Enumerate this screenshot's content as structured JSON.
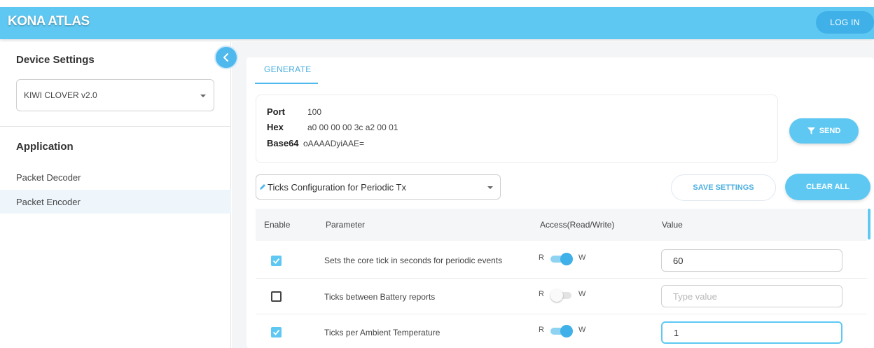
{
  "app": {
    "brand": "KONA ATLAS",
    "login_label": "LOG IN"
  },
  "sidebar": {
    "device_settings_title": "Device Settings",
    "device_selected": "KIWI CLOVER v2.0",
    "application_title": "Application",
    "items": [
      {
        "label": "Packet Decoder",
        "active": false
      },
      {
        "label": "Packet Encoder",
        "active": true
      }
    ]
  },
  "main": {
    "tab_label": "GENERATE",
    "info": {
      "port_label": "Port",
      "port_value": "100",
      "hex_label": "Hex",
      "hex_value": "a0 00 00 00 3c a2 00 01",
      "base64_label": "Base64",
      "base64_value": "oAAAADyiAAE="
    },
    "send_label": "SEND",
    "config_selected": "Ticks Configuration for Periodic Tx",
    "save_settings_label": "SAVE SETTINGS",
    "clear_all_label": "CLEAR ALL",
    "table": {
      "headers": {
        "enable": "Enable",
        "parameter": "Parameter",
        "access": "Access(Read/Write)",
        "value": "Value"
      },
      "r_label": "R",
      "w_label": "W",
      "rows": [
        {
          "enabled": true,
          "parameter": "Sets the core tick in seconds for periodic events",
          "write": true,
          "value": "60",
          "placeholder": ""
        },
        {
          "enabled": false,
          "parameter": "Ticks between Battery reports",
          "write": false,
          "value": "",
          "placeholder": "Type value"
        },
        {
          "enabled": true,
          "parameter": "Ticks per Ambient Temperature",
          "write": true,
          "value": "1",
          "placeholder": ""
        }
      ]
    }
  },
  "colors": {
    "accent": "#5ec8f2",
    "accent_dark": "#3fb0e8",
    "toggle_off": "#d9d9d9"
  },
  "icons": {
    "collapse": "chevron-left-icon",
    "send": "filter-icon",
    "config": "pencil-icon",
    "dropdown": "caret-down-icon"
  }
}
